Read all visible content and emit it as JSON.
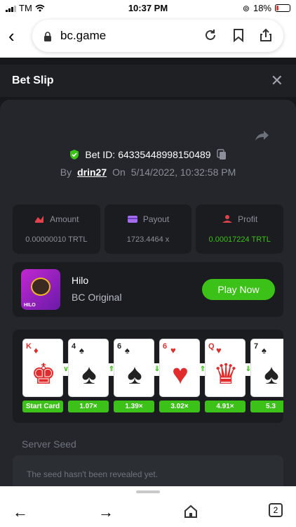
{
  "status_bar": {
    "carrier": "TM",
    "time": "10:37 PM",
    "battery": "18%"
  },
  "browser": {
    "url": "bc.game"
  },
  "header": {
    "title": "Bet Slip"
  },
  "bet": {
    "id_label": "Bet ID:",
    "id": "64335448998150489",
    "by_label": "By",
    "user": "drin27",
    "on_label": "On",
    "date": "5/14/2022, 10:32:58 PM"
  },
  "stats": [
    {
      "label": "Amount",
      "value": "0.00000010 TRTL",
      "icon": "coins-icon"
    },
    {
      "label": "Payout",
      "value": "1723.4464 x",
      "icon": "wallet-icon"
    },
    {
      "label": "Profit",
      "value": "0.00017224 TRTL",
      "icon": "profit-icon"
    }
  ],
  "game": {
    "name": "Hilo",
    "subtitle": "BC Original",
    "play_label": "Play Now",
    "thumb_tag": "HILO"
  },
  "cards": [
    {
      "rank": "K",
      "suit": "♦",
      "color": "red",
      "art": "♚",
      "label": "Start Card"
    },
    {
      "rank": "4",
      "suit": "♠",
      "color": "blk",
      "art": "♠",
      "label": "1.07×"
    },
    {
      "rank": "6",
      "suit": "♠",
      "color": "blk",
      "art": "♠",
      "label": "1.39×"
    },
    {
      "rank": "6",
      "suit": "♥",
      "color": "red",
      "art": "♥",
      "label": "3.02×"
    },
    {
      "rank": "Q",
      "suit": "♥",
      "color": "red",
      "art": "♛",
      "label": "4.91×"
    },
    {
      "rank": "7",
      "suit": "♠",
      "color": "blk",
      "art": "♠",
      "label": "5.3"
    }
  ],
  "arrows": [
    "∨",
    "⇑",
    "⇓",
    "⇑",
    "⇓"
  ],
  "seed": {
    "label": "Server Seed",
    "text": "The seed hasn't been revealed yet."
  },
  "bottom": {
    "tab_count": "2"
  },
  "colors": {
    "accent": "#3bc117",
    "background": "#17181b",
    "panel": "#24262b"
  }
}
